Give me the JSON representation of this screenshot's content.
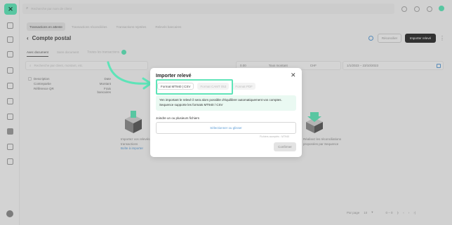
{
  "search": {
    "placeholder": "Recherche par nom de client"
  },
  "nav": {
    "tabs": [
      "Transactions en attente",
      "Transactions réconciliées",
      "Transactions rejetées",
      "Relevés bancaires"
    ]
  },
  "page": {
    "title": "Compte postal",
    "reconcile_label": "Réconcilier",
    "import_label": "Importer relevé",
    "subtabs": [
      "Avec document",
      "Sans document",
      "Toutes les transactions"
    ]
  },
  "filters": {
    "search_placeholder": "Recherche par client, montant, etc.",
    "amount_value": "0.00",
    "amount_label": "Tous montant",
    "amount_currency": "CHF",
    "date_value": "1/1/2023 – 23/10/2023"
  },
  "list": {
    "rows": [
      {
        "left": "Description",
        "right": "Date"
      },
      {
        "left": "Contrepartie",
        "right": "Montant"
      },
      {
        "left": "Référence QR",
        "right": "Frais bancaires"
      }
    ]
  },
  "empty_left": {
    "line1": "Importez vos relevés",
    "line2": "transactions",
    "link": "Boîte à importer"
  },
  "empty_right": {
    "line1": "Réalisez les réconciliations",
    "line2": "proposées par Sequence"
  },
  "modal": {
    "title": "Importer relevé",
    "format_tabs": [
      "Format MT940 | CSV",
      "Format CAMT 053",
      "Format PDF"
    ],
    "info_line1": "Yen important le relevé il sera alors possible d'équilibrer automatiquement vos comptes.",
    "info_line2": "Sequence supporte les formats MT940 / CSV",
    "upload_label": "Joindre un ou plusieurs fichiers",
    "upload_cta": "Sélectionner ou glisser",
    "upload_hint": "Fichiers acceptés : MT940",
    "confirm_label": "Confirmer"
  },
  "pager": {
    "per_page_label": "Par page",
    "per_page_value": "10",
    "range": "0 – 0"
  },
  "colors": {
    "accent": "#5ee4b8",
    "link": "#5b9bd5",
    "dark_button": "#303030"
  }
}
